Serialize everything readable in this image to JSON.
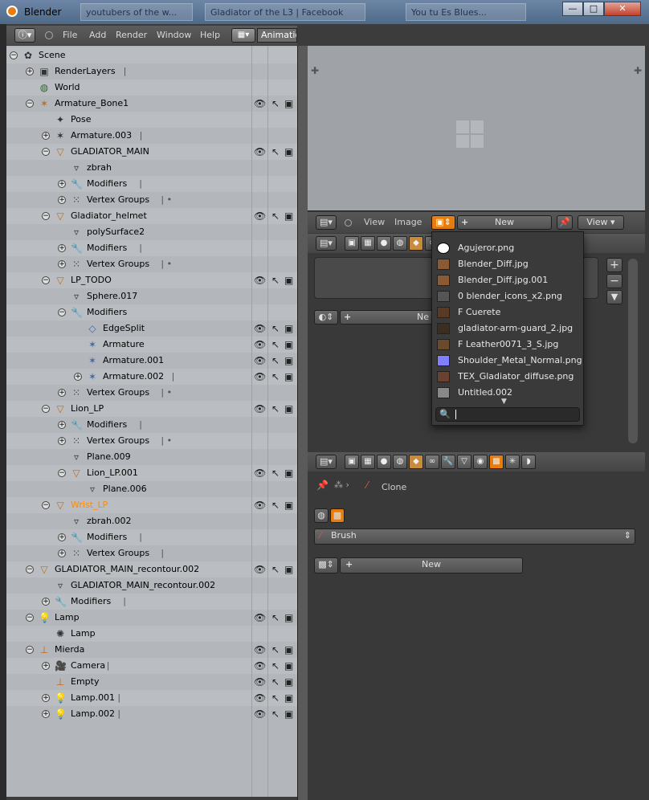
{
  "window": {
    "title": "Blender",
    "ghost_tabs": [
      "youtubers of the w...",
      "Gladiator of the L3 | Facebook",
      "You tu Es Blues..."
    ],
    "controls": {
      "minimize": "—",
      "maximize": "□",
      "close": "✕"
    }
  },
  "menubar": {
    "info_icon": "info-icon",
    "items": [
      "File",
      "Add",
      "Render",
      "Window",
      "Help"
    ],
    "screen": "Animatio"
  },
  "outliner": {
    "rows": [
      {
        "label": "Scene",
        "indent": 0,
        "expander": "minus",
        "icon": "scene-icon",
        "vis": false
      },
      {
        "label": "RenderLayers",
        "indent": 1,
        "expander": "plus",
        "icon": "renderlayers-icon",
        "extra": "|",
        "vis": false
      },
      {
        "label": "World",
        "indent": 1,
        "expander": "",
        "icon": "world-icon",
        "vis": false
      },
      {
        "label": "Armature_Bone1",
        "indent": 1,
        "expander": "minus",
        "icon": "armature-icon",
        "vis": true
      },
      {
        "label": "Pose",
        "indent": 2,
        "expander": "",
        "icon": "pose-icon",
        "vis": false
      },
      {
        "label": "Armature.003",
        "indent": 2,
        "expander": "plus",
        "icon": "armature-data-icon",
        "extra": "|",
        "vis": false
      },
      {
        "label": "GLADIATOR_MAIN",
        "indent": 2,
        "expander": "minus",
        "icon": "mesh-icon",
        "vis": true
      },
      {
        "label": "zbrah",
        "indent": 3,
        "expander": "",
        "icon": "mesh-data-icon",
        "vis": false
      },
      {
        "label": "Modifiers",
        "indent": 3,
        "expander": "plus",
        "icon": "wrench-icon",
        "extra": "|",
        "vis": false
      },
      {
        "label": "Vertex Groups",
        "indent": 3,
        "expander": "plus",
        "icon": "vertex-groups-icon",
        "extra": "|  •",
        "vis": false
      },
      {
        "label": "Gladiator_helmet",
        "indent": 2,
        "expander": "minus",
        "icon": "mesh-icon",
        "vis": true
      },
      {
        "label": "polySurface2",
        "indent": 3,
        "expander": "",
        "icon": "mesh-data-icon",
        "vis": false
      },
      {
        "label": "Modifiers",
        "indent": 3,
        "expander": "plus",
        "icon": "wrench-icon",
        "extra": "|",
        "vis": false
      },
      {
        "label": "Vertex Groups",
        "indent": 3,
        "expander": "plus",
        "icon": "vertex-groups-icon",
        "extra": "|  •",
        "vis": false
      },
      {
        "label": "LP_TODO",
        "indent": 2,
        "expander": "minus",
        "icon": "mesh-icon",
        "vis": true
      },
      {
        "label": "Sphere.017",
        "indent": 3,
        "expander": "",
        "icon": "mesh-data-icon",
        "vis": false
      },
      {
        "label": "Modifiers",
        "indent": 3,
        "expander": "minus",
        "icon": "wrench-icon",
        "vis": false
      },
      {
        "label": "EdgeSplit",
        "indent": 4,
        "expander": "",
        "icon": "edgesplit-icon",
        "vis": true
      },
      {
        "label": "Armature",
        "indent": 4,
        "expander": "",
        "icon": "armature-mod-icon",
        "vis": true
      },
      {
        "label": "Armature.001",
        "indent": 4,
        "expander": "",
        "icon": "armature-mod-icon",
        "vis": true
      },
      {
        "label": "Armature.002",
        "indent": 4,
        "expander": "plus",
        "icon": "armature-mod-icon",
        "extra": "|",
        "vis": true
      },
      {
        "label": "Vertex Groups",
        "indent": 3,
        "expander": "plus",
        "icon": "vertex-groups-icon",
        "extra": "|  •",
        "vis": false
      },
      {
        "label": "Lion_LP",
        "indent": 2,
        "expander": "minus",
        "icon": "mesh-icon",
        "vis": true
      },
      {
        "label": "Modifiers",
        "indent": 3,
        "expander": "plus",
        "icon": "wrench-icon",
        "extra": "|",
        "vis": false
      },
      {
        "label": "Vertex Groups",
        "indent": 3,
        "expander": "plus",
        "icon": "vertex-groups-icon",
        "extra": "|  •",
        "vis": false
      },
      {
        "label": "Plane.009",
        "indent": 3,
        "expander": "",
        "icon": "mesh-data-icon",
        "vis": false
      },
      {
        "label": "Lion_LP.001",
        "indent": 3,
        "expander": "minus",
        "icon": "mesh-icon",
        "vis": true
      },
      {
        "label": "Plane.006",
        "indent": 4,
        "expander": "",
        "icon": "mesh-data-icon",
        "vis": false
      },
      {
        "label": "Wrist_LP",
        "indent": 2,
        "expander": "minus",
        "icon": "mesh-icon",
        "vis": true,
        "highlight": true
      },
      {
        "label": "zbrah.002",
        "indent": 3,
        "expander": "",
        "icon": "mesh-data-icon",
        "vis": false
      },
      {
        "label": "Modifiers",
        "indent": 3,
        "expander": "plus",
        "icon": "wrench-icon",
        "extra": "|",
        "vis": false
      },
      {
        "label": "Vertex Groups",
        "indent": 3,
        "expander": "plus",
        "icon": "vertex-groups-icon",
        "extra": "|",
        "vis": false
      },
      {
        "label": "GLADIATOR_MAIN_recontour.002",
        "indent": 1,
        "expander": "minus",
        "icon": "mesh-icon",
        "vis": true
      },
      {
        "label": "GLADIATOR_MAIN_recontour.002",
        "indent": 2,
        "expander": "",
        "icon": "mesh-data-icon",
        "vis": false
      },
      {
        "label": "Modifiers",
        "indent": 2,
        "expander": "plus",
        "icon": "wrench-icon",
        "extra": "|",
        "vis": false
      },
      {
        "label": "Lamp",
        "indent": 1,
        "expander": "minus",
        "icon": "lamp-icon",
        "vis": true
      },
      {
        "label": "Lamp",
        "indent": 2,
        "expander": "",
        "icon": "lamp-data-icon",
        "vis": false
      },
      {
        "label": "Mierda",
        "indent": 1,
        "expander": "minus",
        "icon": "empty-icon",
        "vis": true
      },
      {
        "label": "Camera",
        "indent": 2,
        "expander": "plus",
        "icon": "camera-icon",
        "extra": "|",
        "vis": true
      },
      {
        "label": "Empty",
        "indent": 2,
        "expander": "",
        "icon": "empty-icon",
        "vis": true
      },
      {
        "label": "Lamp.001",
        "indent": 2,
        "expander": "plus",
        "icon": "lamp-icon",
        "extra": "|",
        "vis": true
      },
      {
        "label": "Lamp.002",
        "indent": 2,
        "expander": "plus",
        "icon": "lamp-icon",
        "extra": "|",
        "vis": true
      }
    ]
  },
  "image_editor": {
    "view_label": "View",
    "image_label": "Image",
    "new_label": "New",
    "view_menu": "View"
  },
  "image_browser": {
    "items": [
      {
        "name": "Agujeror.png",
        "thumb": "#ffffff"
      },
      {
        "name": "Blender_Diff.jpg",
        "thumb": "#8a5a34"
      },
      {
        "name": "Blender_Diff.jpg.001",
        "thumb": "#8a5a34"
      },
      {
        "name": "0 blender_icons_x2.png",
        "thumb": "#555555"
      },
      {
        "name": "F Cuerete",
        "thumb": "#5a3a22"
      },
      {
        "name": "gladiator-arm-guard_2.jpg",
        "thumb": "#3a2e20"
      },
      {
        "name": "F Leather0071_3_S.jpg",
        "thumb": "#6b4a2c"
      },
      {
        "name": "Shoulder_Metal_Normal.png",
        "thumb": "#7f7fff"
      },
      {
        "name": "TEX_Gladiator_diffuse.png",
        "thumb": "#6a4030"
      },
      {
        "name": "Untitled.002",
        "thumb": "#888888"
      }
    ],
    "search_placeholder": ""
  },
  "properties_top": {
    "new_label": "Ne"
  },
  "texture_panel": {
    "clone_label": "Clone",
    "brush_label": "Brush",
    "new_label": "New"
  },
  "colors": {
    "accent": "#e87d0d",
    "highlight_text": "#ff8c00",
    "panel_bg": "#393939",
    "outliner_bg": "#b3b6bb"
  }
}
